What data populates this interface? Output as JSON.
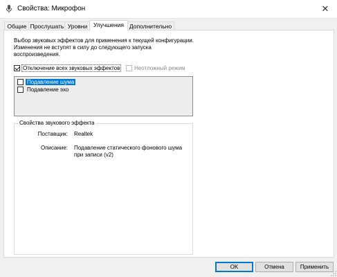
{
  "window": {
    "title": "Свойства: Микрофон",
    "close_glyph": "✕"
  },
  "tabs": [
    {
      "label": "Общие"
    },
    {
      "label": "Прослушать"
    },
    {
      "label": "Уровни"
    },
    {
      "label": "Улучшения",
      "active": true
    },
    {
      "label": "Дополнительно"
    }
  ],
  "enhancements": {
    "description": "Выбор звуковых эффектов для применения к текущей конфигурации. Изменения не вступят в силу до следующего запуска воспроизведения.",
    "disable_all": {
      "label": "Отключение всех звуковых эффектов",
      "checked": true
    },
    "urgent_mode": {
      "label": "Неотложный режим",
      "checked": false,
      "enabled": false
    },
    "effects": [
      {
        "label": "Подавление шума",
        "checked": false,
        "selected": true
      },
      {
        "label": "Подавление эхо",
        "checked": false,
        "selected": false
      }
    ],
    "properties": {
      "legend": "Свойства звукового эффекта",
      "provider_label": "Поставщик:",
      "provider_value": "Realtek",
      "description_label": "Описание:",
      "description_line1": "Подавление статического фонового шума",
      "description_line2": "при записи (v2)"
    }
  },
  "buttons": {
    "ok": "OK",
    "cancel": "Отмена",
    "apply": "Применить"
  },
  "colors": {
    "selection": "#0078d7",
    "window_bg": "#f0f0f0"
  }
}
